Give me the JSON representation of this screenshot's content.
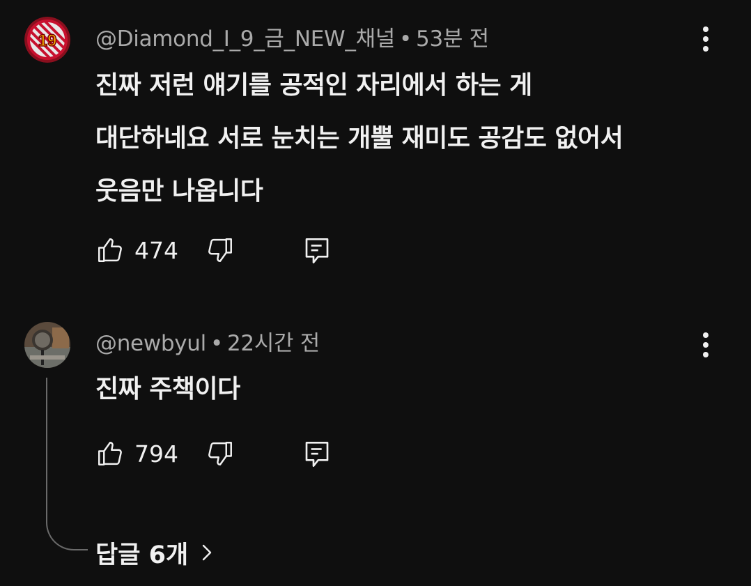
{
  "comments": [
    {
      "author": "@Diamond_I_9_금_NEW_채널",
      "separator": "•",
      "time": "53분 전",
      "avatar_text": "19",
      "text_lines": [
        "진짜 저런 얘기를 공적인 자리에서 하는 게",
        "대단하네요 서로 눈치는 개뿔 재미도 공감도 없어서",
        "웃음만 나옵니다"
      ],
      "likes": "474"
    },
    {
      "author": "@newbyul",
      "separator": "•",
      "time": "22시간 전",
      "text_lines": [
        "진짜 주책이다"
      ],
      "likes": "794"
    }
  ],
  "replies_label": "답글 6개",
  "icons": {
    "like": "thumb-up-icon",
    "dislike": "thumb-down-icon",
    "reply": "comment-reply-icon",
    "more": "more-vert-icon",
    "chevron": "chevron-right-icon"
  },
  "colors": {
    "background": "#0f0f0f",
    "text": "#f1f1f1",
    "meta": "#aaaaaa",
    "avatar1_ring": "#c8102e"
  }
}
